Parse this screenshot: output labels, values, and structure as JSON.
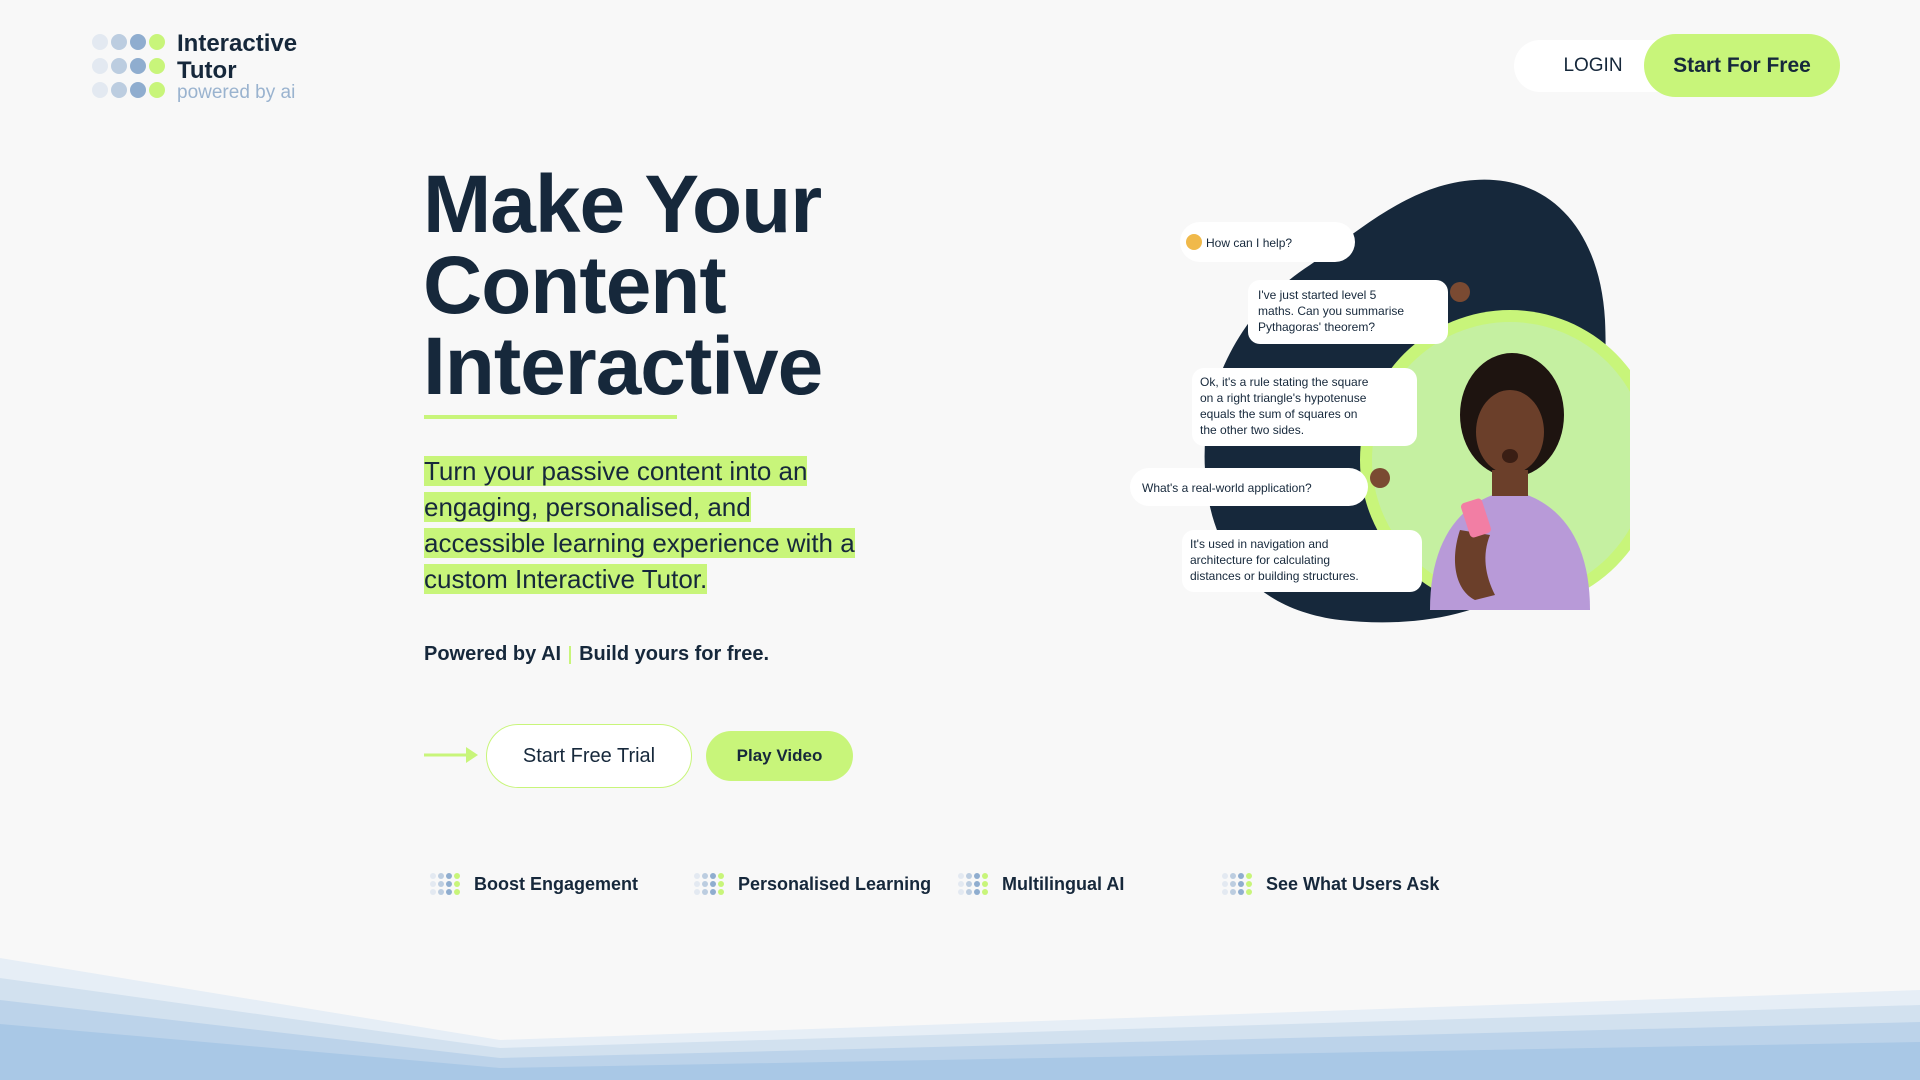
{
  "header": {
    "logo_line1": "Interactive",
    "logo_line2": "Tutor",
    "logo_tagline": "powered by ai",
    "login_label": "LOGIN",
    "start_free_label": "Start For Free"
  },
  "hero": {
    "title_line1": "Make Your",
    "title_line2": "Content",
    "title_line3": "Interactive",
    "description": "Turn your passive content into an engaging, personalised, and accessible learning experience with a custom Interactive Tutor.",
    "powered_text": "Powered by AI",
    "build_text": "Build yours for free.",
    "trial_label": "Start Free Trial",
    "video_label": "Play Video"
  },
  "chat": {
    "msg1": "How can I help?",
    "msg2_lines": [
      "I've just started level 5",
      "maths. Can you summarise",
      "Pythagoras' theorem?"
    ],
    "msg3_lines": [
      "Ok, it's a rule stating the square",
      "on a right triangle's hypotenuse",
      "equals the sum of squares on",
      "the other two sides."
    ],
    "msg4": "What's a real-world application?",
    "msg5_lines": [
      "It's used in navigation and",
      "architecture for calculating",
      "distances or building structures."
    ]
  },
  "features": [
    {
      "label": "Boost Engagement",
      "icon": "dots-icon"
    },
    {
      "label": "Personalised Learning",
      "icon": "dots-icon"
    },
    {
      "label": "Multilingual AI",
      "icon": "dots-icon"
    },
    {
      "label": "See What Users Ask",
      "icon": "dots-icon"
    }
  ],
  "colors": {
    "navy": "#16283b",
    "lime": "#c8f57a",
    "light_blue": "#9ab3cf",
    "background": "#f8f8f8"
  }
}
